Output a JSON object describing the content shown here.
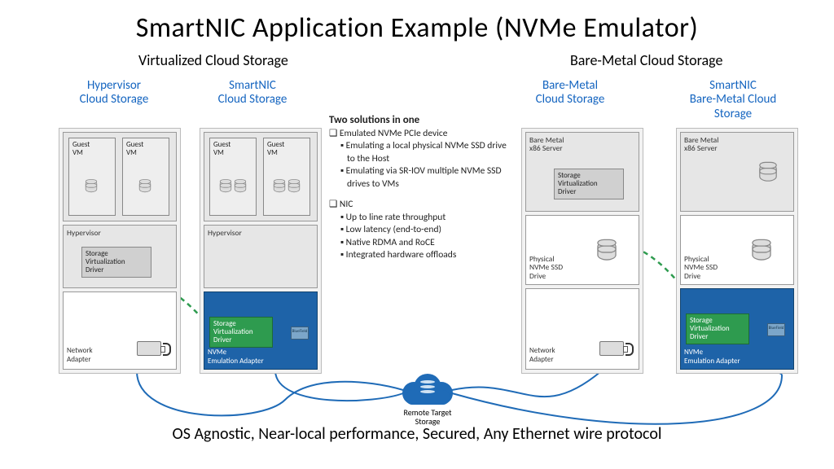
{
  "title": "SmartNIC Application Example (NVMe Emulator)",
  "sections": {
    "left": "Virtualized Cloud Storage",
    "right": "Bare-Metal Cloud Storage"
  },
  "columns": {
    "c1": "Hypervisor\nCloud Storage",
    "c2": "SmartNIC\nCloud Storage",
    "c3": "Bare-Metal\nCloud Storage",
    "c4": "SmartNIC\nBare-Metal Cloud\nStorage"
  },
  "labels": {
    "guest_vm": "Guest\nVM",
    "hypervisor": "Hypervisor",
    "svd": "Storage\nVirtualization\nDriver",
    "network_adapter": "Network\nAdapter",
    "nvme_adapter": "NVMe\nEmulation Adapter",
    "bm_server": "Bare Metal\nx86 Server",
    "phy_nvme": "Physical\nNVMe SSD\nDrive",
    "bluefield": "BlueField",
    "remote": "Remote Target\nStorage"
  },
  "center": {
    "heading": "Two solutions in one",
    "sq1": "Emulated NVMe PCIe device",
    "b1": "Emulating a local physical NVMe SSD drive to the Host",
    "b2": "Emulating via SR-IOV multiple NVMe SSD drives to VMs",
    "sq2": "NIC",
    "b3": "Up to line rate throughput",
    "b4": "Low latency (end-to-end)",
    "b5": "Native RDMA and RoCE",
    "b6": "Integrated hardware offloads"
  },
  "footer": "OS Agnostic, Near-local performance, Secured, Any Ethernet wire protocol"
}
